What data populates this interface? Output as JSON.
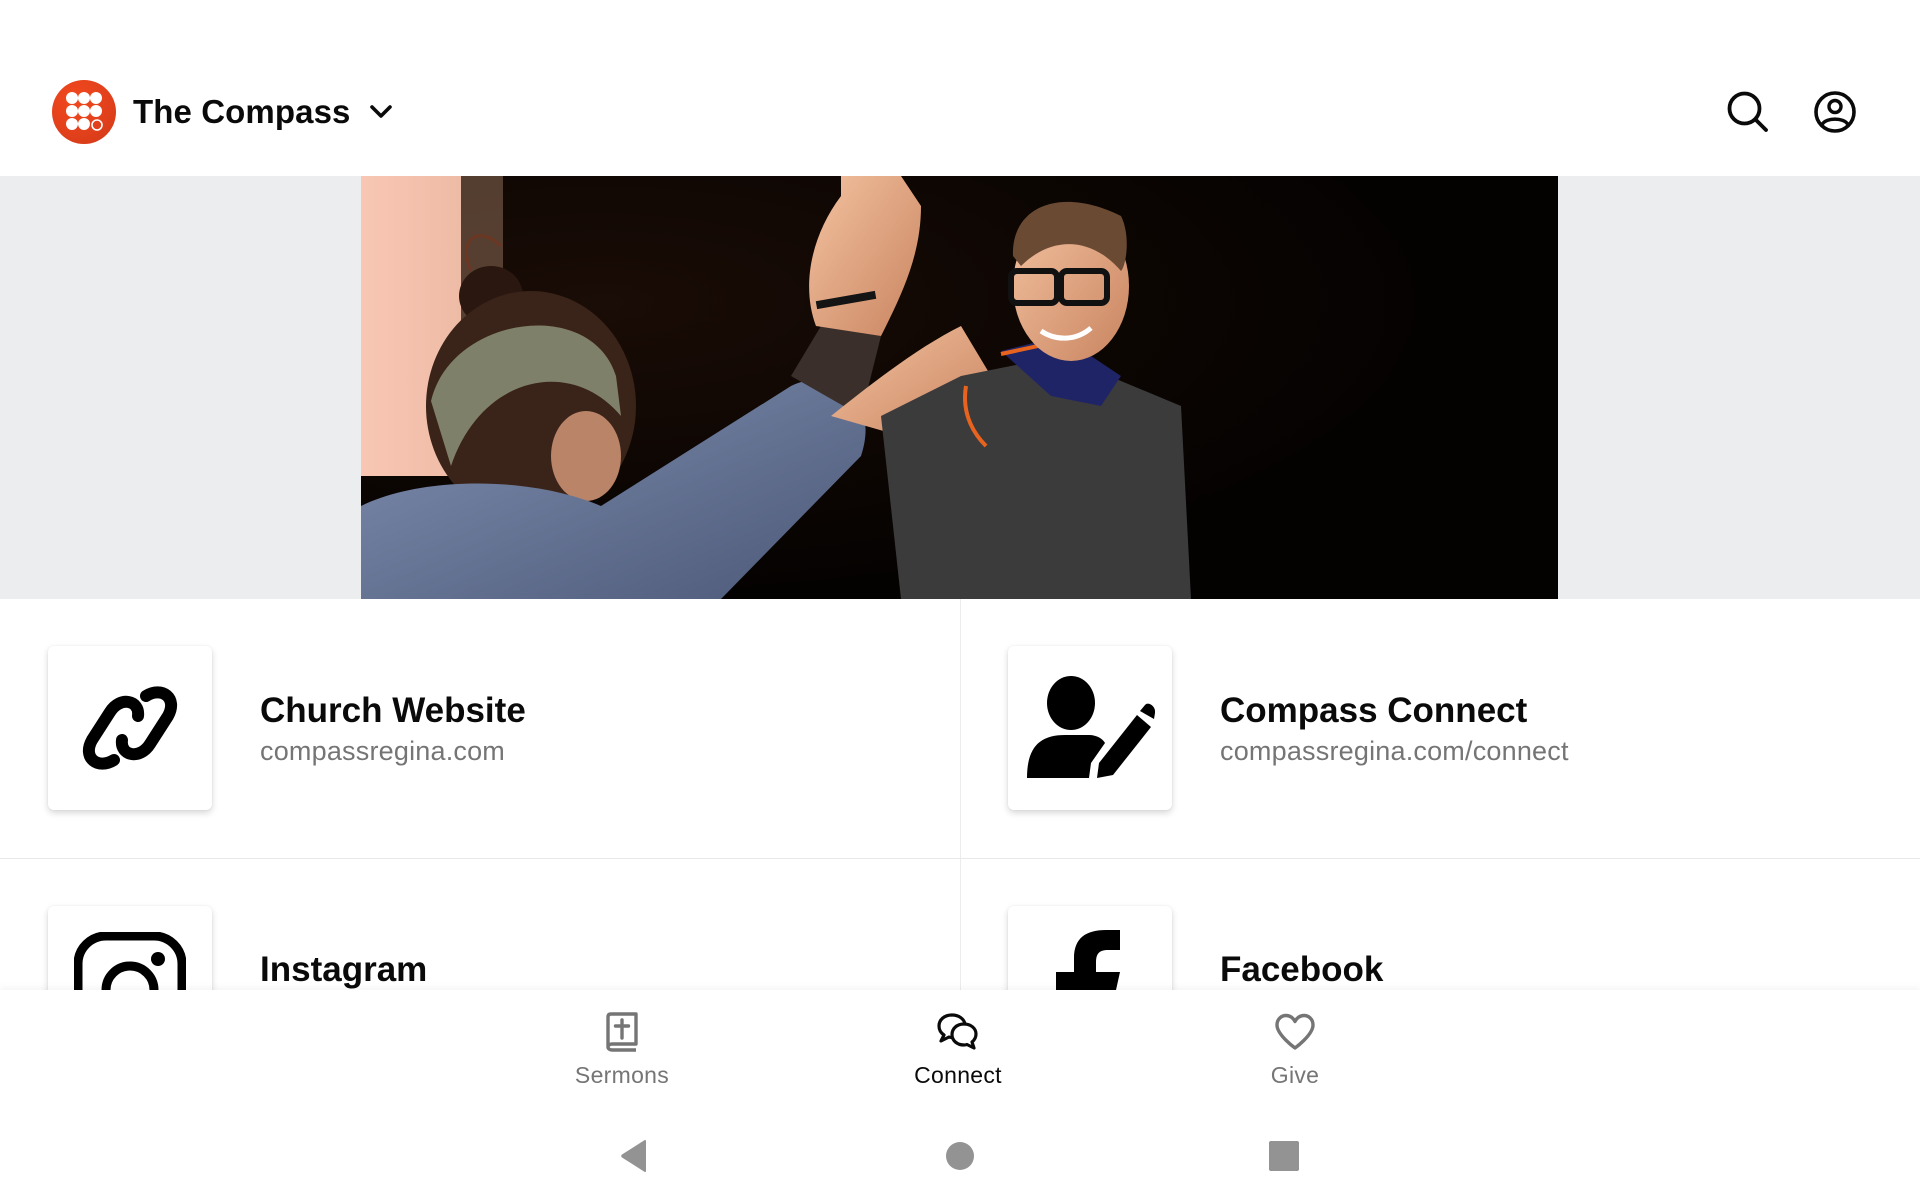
{
  "header": {
    "title": "The Compass",
    "logo_icon": "dot-grid-logo",
    "brand_color": "#e2401b",
    "chevron_icon": "chevron-down-icon",
    "search_icon": "search-icon",
    "profile_icon": "account-circle-icon"
  },
  "hero": {
    "image_description": "Two people giving each other a high five in a dark room"
  },
  "links": [
    {
      "title": "Church Website",
      "subtitle": "compassregina.com",
      "icon": "link-icon"
    },
    {
      "title": "Compass Connect",
      "subtitle": "compassregina.com/connect",
      "icon": "user-edit-icon"
    },
    {
      "title": "Instagram",
      "subtitle": "",
      "icon": "instagram-icon"
    },
    {
      "title": "Facebook",
      "subtitle": "",
      "icon": "facebook-icon"
    }
  ],
  "bottom_nav": {
    "active": "Connect",
    "items": [
      {
        "label": "Sermons",
        "icon": "bible-icon"
      },
      {
        "label": "Connect",
        "icon": "chat-bubbles-icon"
      },
      {
        "label": "Give",
        "icon": "heart-icon"
      }
    ]
  },
  "system_nav": {
    "back_icon": "back-triangle-icon",
    "home_icon": "home-circle-icon",
    "recents_icon": "recents-square-icon",
    "color": "#939393"
  }
}
